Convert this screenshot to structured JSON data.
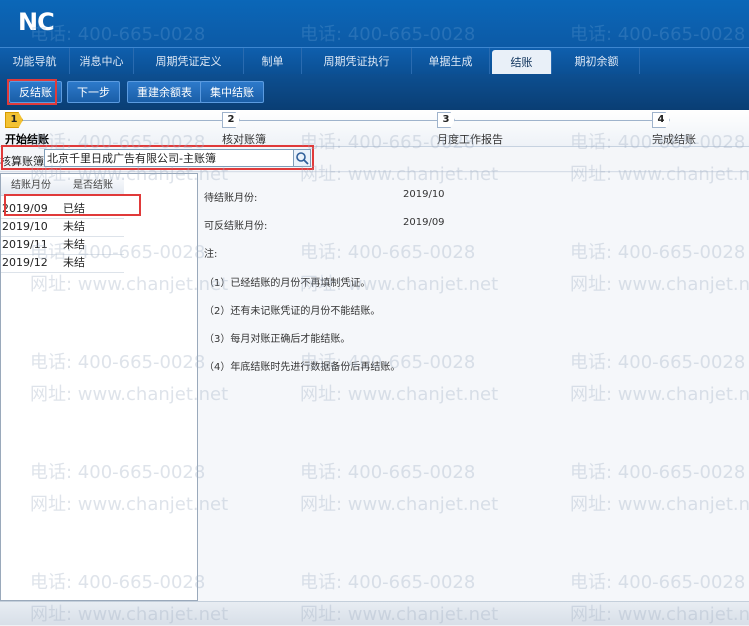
{
  "app": {
    "logo": "NC"
  },
  "tabs": [
    {
      "label": "功能导航"
    },
    {
      "label": "消息中心"
    },
    {
      "label": "周期凭证定义"
    },
    {
      "label": "制单"
    },
    {
      "label": "周期凭证执行"
    },
    {
      "label": "单据生成"
    },
    {
      "label": "结账"
    },
    {
      "label": "期初余额"
    }
  ],
  "active_tab": "结账",
  "toolbar": {
    "anti_close": "反结账",
    "next_step": "下一步",
    "rebuild_balance": "重建余额表",
    "batch_close": "集中结账"
  },
  "steps": [
    {
      "num": "1",
      "label": "开始结账",
      "active": true
    },
    {
      "num": "2",
      "label": "核对账簿",
      "active": false
    },
    {
      "num": "3",
      "label": "月度工作报告",
      "active": false
    },
    {
      "num": "4",
      "label": "完成结账",
      "active": false
    }
  ],
  "book": {
    "label": "核算账簿",
    "value": "北京千里日成广告有限公司-主账簿"
  },
  "table": {
    "headers": [
      "结账月份",
      "是否结账"
    ],
    "rows": [
      {
        "month": "2019/09",
        "status": "已结"
      },
      {
        "month": "2019/10",
        "status": "未结"
      },
      {
        "month": "2019/11",
        "status": "未结"
      },
      {
        "month": "2019/12",
        "status": "未结"
      }
    ]
  },
  "info": {
    "pending_label": "待结账月份:",
    "pending_value": "2019/10",
    "reversible_label": "可反结账月份:",
    "reversible_value": "2019/09",
    "note_label": "注:",
    "notes": [
      "（1）已经结账的月份不再填制凭证。",
      "（2）还有未记账凭证的月份不能结账。",
      "（3）每月对账正确后才能结账。",
      "（4）年底结账时先进行数据备份后再结账。"
    ]
  },
  "watermark": {
    "phone": "电话: 400-665-0028",
    "site": "网址: www.chanjet.net"
  },
  "colors": {
    "brand_blue": "#0b5ba8",
    "highlight_red": "#e03a3a",
    "step_active": "#f3c233"
  }
}
